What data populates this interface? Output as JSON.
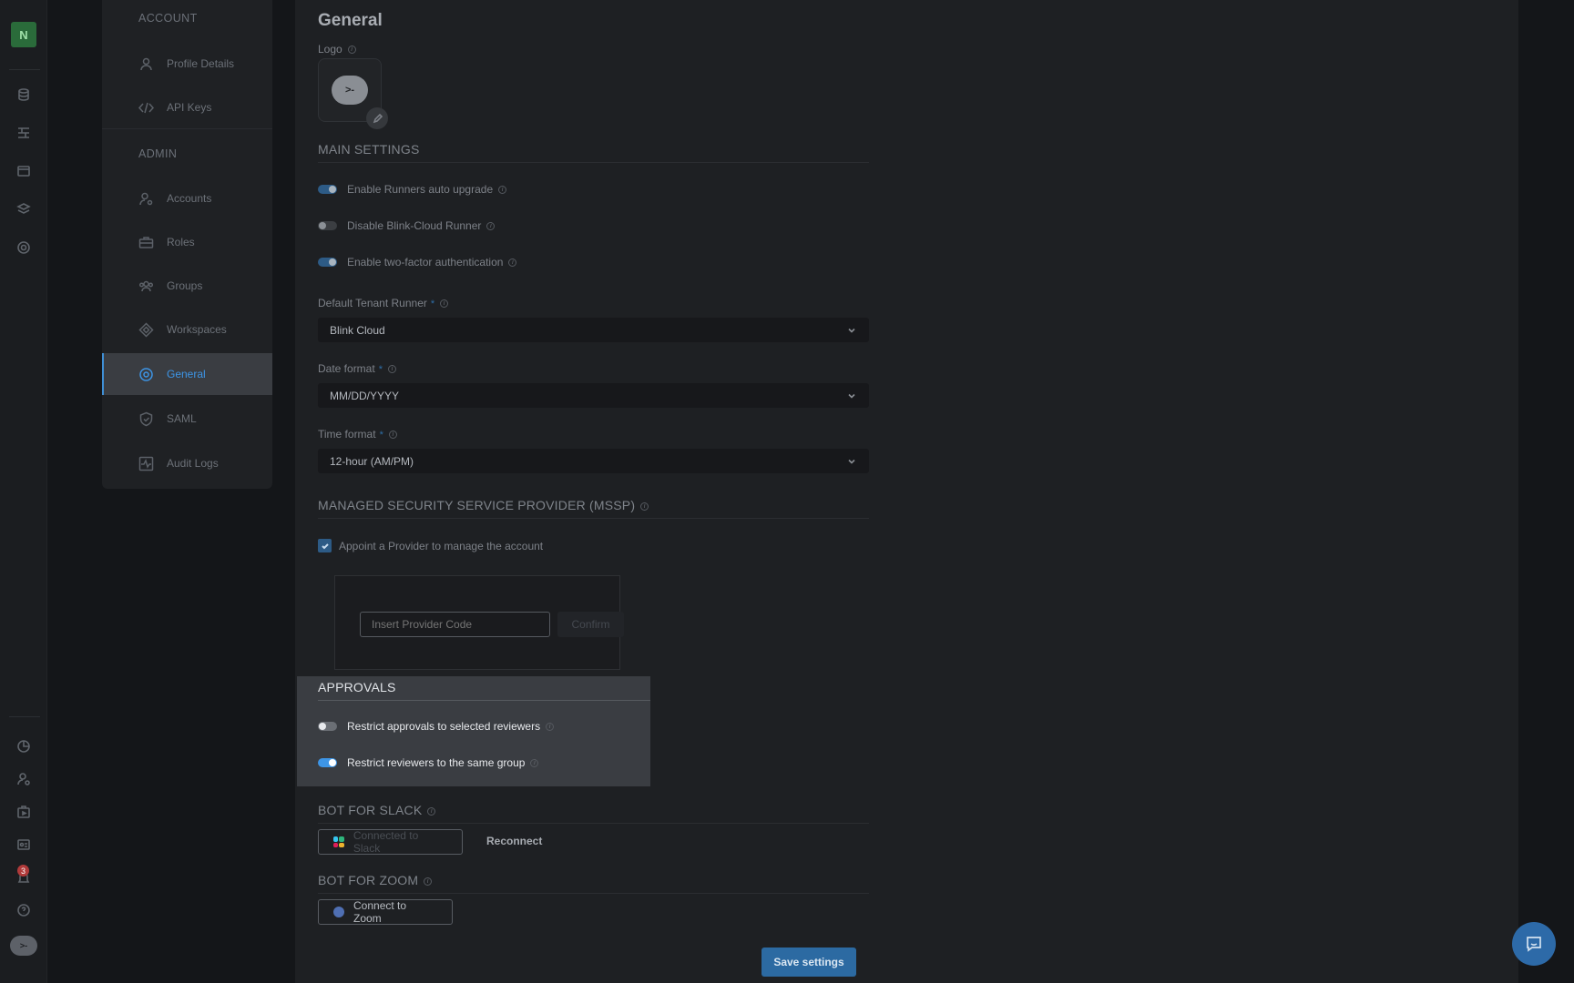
{
  "rail": {
    "workspace_initial": "N",
    "icons": [
      "database-icon",
      "flows-icon",
      "window-icon",
      "layers-icon",
      "target-icon",
      "chart-pie-icon",
      "user-gear-icon",
      "runner-icon",
      "id-card-icon",
      "notifications-icon",
      "help-icon"
    ],
    "notification_count": "3",
    "avatar_text": ">-"
  },
  "nav": {
    "account_header": "ACCOUNT",
    "admin_header": "ADMIN",
    "items": [
      {
        "label": "Profile Details",
        "icon": "user-icon"
      },
      {
        "label": "API Keys",
        "icon": "code-icon"
      },
      {
        "label": "Accounts",
        "icon": "user-cog-icon"
      },
      {
        "label": "Roles",
        "icon": "briefcase-icon"
      },
      {
        "label": "Groups",
        "icon": "group-icon"
      },
      {
        "label": "Workspaces",
        "icon": "diamond-icon"
      },
      {
        "label": "General",
        "icon": "gear-target-icon"
      },
      {
        "label": "SAML",
        "icon": "shield-icon"
      },
      {
        "label": "Audit Logs",
        "icon": "activity-icon"
      }
    ]
  },
  "general": {
    "title": "General",
    "logo_label": "Logo",
    "logo_text": ">-",
    "main_settings": {
      "header": "MAIN SETTINGS",
      "toggles": [
        {
          "label": "Enable Runners auto upgrade",
          "on": true
        },
        {
          "label": "Disable Blink-Cloud Runner",
          "on": false
        },
        {
          "label": "Enable two-factor authentication",
          "on": true
        }
      ],
      "default_runner_label": "Default Tenant Runner",
      "default_runner_value": "Blink Cloud",
      "date_format_label": "Date format",
      "date_format_value": "MM/DD/YYYY",
      "time_format_label": "Time format",
      "time_format_value": "12-hour (AM/PM)",
      "required_mark": "*",
      "info_mark": "i"
    },
    "mssp": {
      "header": "MANAGED SECURITY SERVICE PROVIDER (MSSP)",
      "checkbox_label": "Appoint a Provider to manage the account",
      "checked": true,
      "input_placeholder": "Insert Provider Code",
      "confirm_label": "Confirm"
    },
    "approvals": {
      "header": "APPROVALS",
      "toggles": [
        {
          "label": "Restrict approvals to selected reviewers",
          "on": false
        },
        {
          "label": "Restrict reviewers to the same group",
          "on": true
        }
      ]
    },
    "slack": {
      "header": "BOT FOR SLACK",
      "connected_label": "Connected to Slack",
      "reconnect_label": "Reconnect"
    },
    "zoom": {
      "header": "BOT FOR ZOOM",
      "connect_label": "Connect to Zoom"
    },
    "save_label": "Save settings"
  },
  "colors": {
    "accent": "#3d95e6",
    "save_button": "#2c6aa2",
    "workspace_badge": "#2a6b3a"
  }
}
